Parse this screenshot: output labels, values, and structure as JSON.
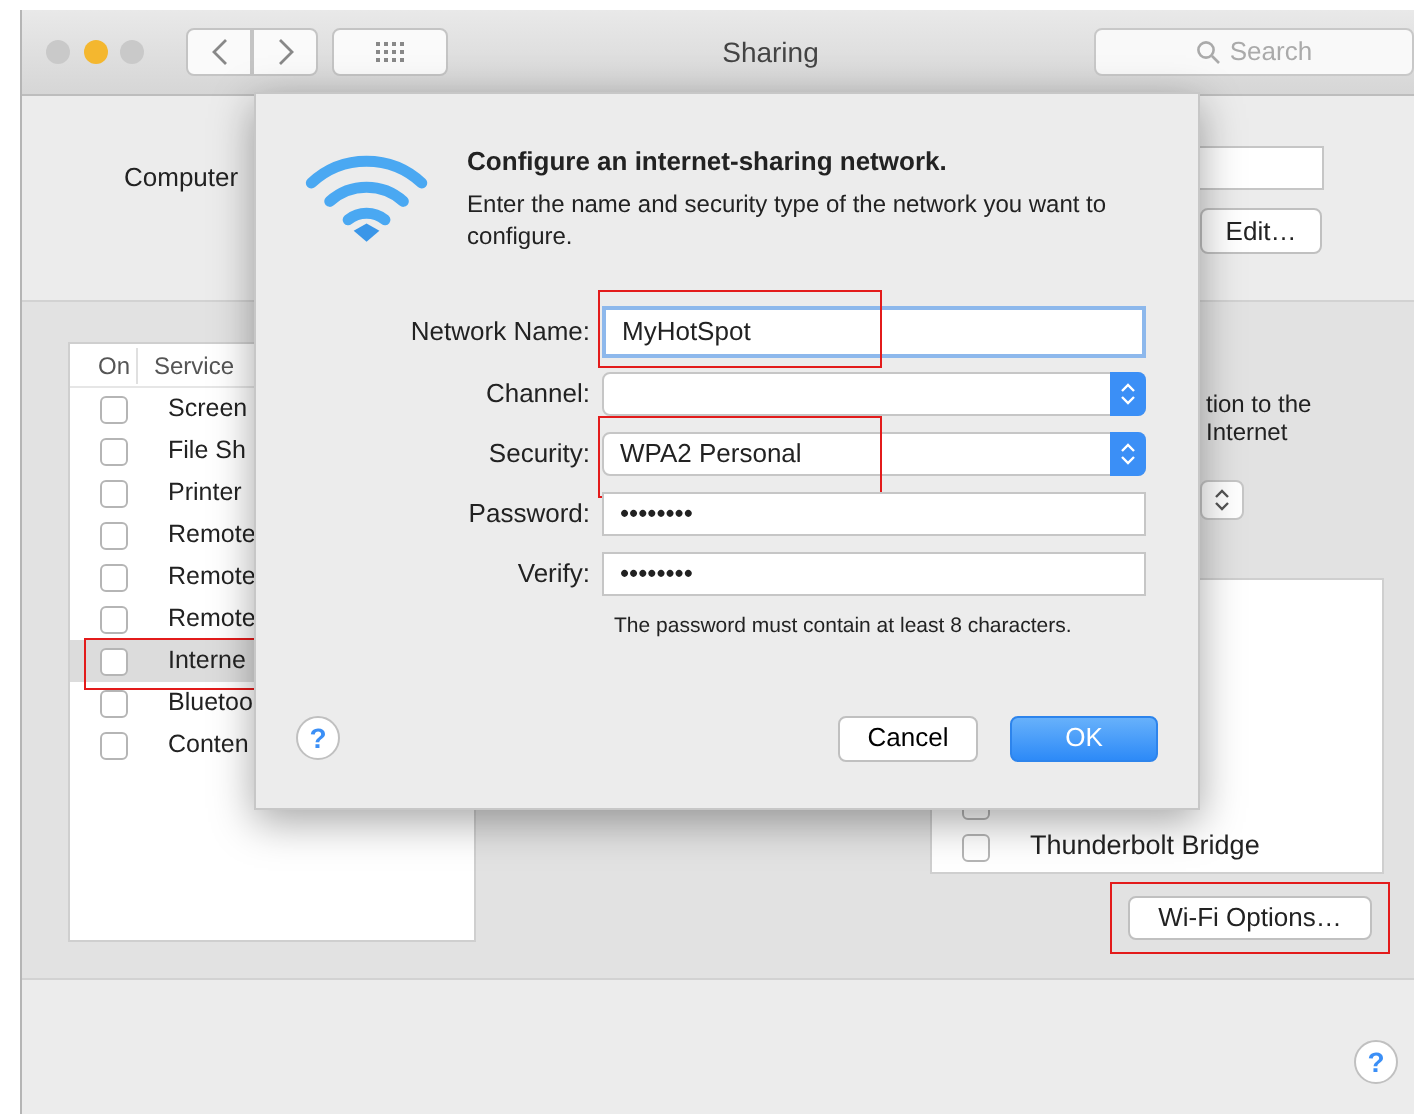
{
  "window": {
    "title": "Sharing",
    "search_placeholder": "Search",
    "traffic_lights": [
      {
        "color": "#c9c9c9"
      },
      {
        "color": "#f4b72f"
      },
      {
        "color": "#c9c9c9"
      }
    ]
  },
  "computer_name": {
    "label": "Computer",
    "edit_button": "Edit…"
  },
  "services": {
    "columns": [
      "On",
      "Service"
    ],
    "rows": [
      {
        "name": "Screen",
        "checked": false,
        "selected": false,
        "highlighted": false
      },
      {
        "name": "File Sh",
        "checked": false,
        "selected": false,
        "highlighted": false
      },
      {
        "name": "Printer",
        "checked": false,
        "selected": false,
        "highlighted": false
      },
      {
        "name": "Remote",
        "checked": false,
        "selected": false,
        "highlighted": false
      },
      {
        "name": "Remote",
        "checked": false,
        "selected": false,
        "highlighted": false
      },
      {
        "name": "Remote",
        "checked": false,
        "selected": false,
        "highlighted": false
      },
      {
        "name": "Interne",
        "checked": false,
        "selected": true,
        "highlighted": true
      },
      {
        "name": "Bluetoo",
        "checked": false,
        "selected": false,
        "highlighted": false
      },
      {
        "name": "Conten",
        "checked": false,
        "selected": false,
        "highlighted": false
      }
    ]
  },
  "right_panel": {
    "description": [
      "tion to the",
      "Internet"
    ],
    "interfaces": [
      {
        "checked": false
      },
      {
        "name": "Thunderbolt Bridge",
        "checked": false
      }
    ],
    "wifi_options": {
      "label": "Wi-Fi Options…",
      "highlighted": true
    }
  },
  "dialog": {
    "title": "Configure an internet-sharing network.",
    "description": "Enter the name and security type of the network you want to configure.",
    "fields": [
      {
        "kind": "text",
        "label": "Network Name:",
        "value": "MyHotSpot",
        "focused": true,
        "highlighted": true
      },
      {
        "kind": "select",
        "label": "Channel:",
        "focused": false,
        "highlighted": false
      },
      {
        "kind": "select",
        "label": "Security:",
        "value": "WPA2 Personal",
        "focused": false,
        "highlighted": true
      },
      {
        "kind": "text",
        "label": "Password:",
        "value": "••••••••",
        "focused": false,
        "highlighted": false
      },
      {
        "kind": "text",
        "label": "Verify:",
        "value": "••••••••",
        "focused": false,
        "highlighted": false
      }
    ],
    "hint": "The password must contain at least 8 characters.",
    "help": "?",
    "buttons": [
      {
        "label": "Cancel",
        "default": false
      },
      {
        "label": "OK",
        "default": true
      }
    ]
  },
  "help": "?"
}
